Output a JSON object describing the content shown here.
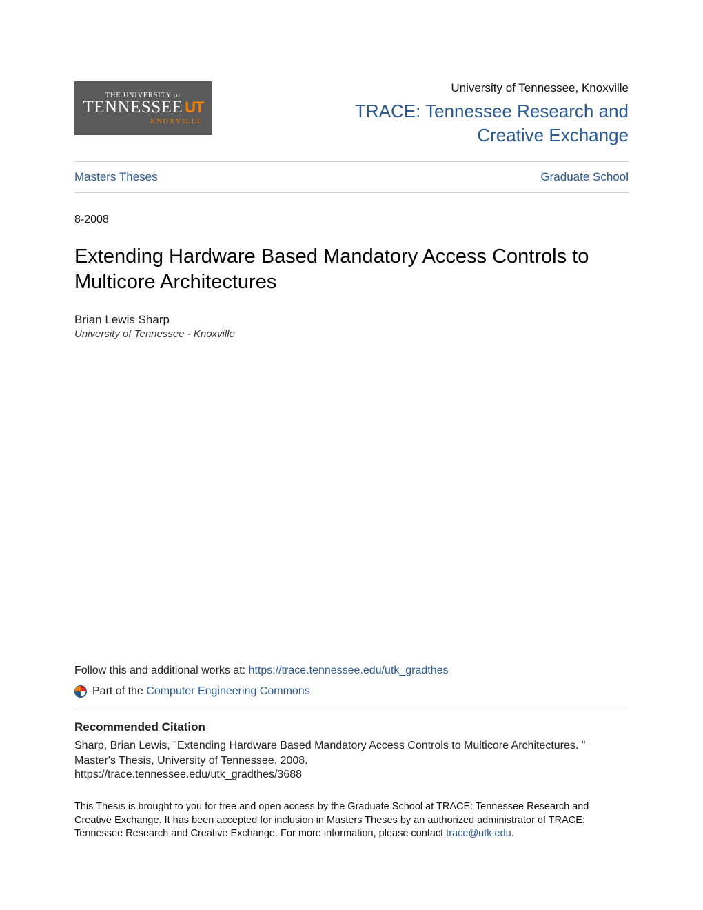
{
  "header": {
    "logo": {
      "line1": "THE UNIVERSITY of",
      "line2": "TENNESSEE",
      "ut_mark": "UT",
      "line3": "KNOXVILLE"
    },
    "institution": "University of Tennessee, Knoxville",
    "trace_label_prefix": "TRACE: ",
    "trace_label_rest": "Tennessee Research and Creative Exchange",
    "trace_full": "TRACE: Tennessee Research and Creative Exchange"
  },
  "nav": {
    "left_link": "Masters Theses",
    "right_link": "Graduate School"
  },
  "date": "8-2008",
  "title": "Extending Hardware Based Mandatory Access Controls to Multicore Architectures",
  "author": {
    "name": "Brian Lewis Sharp",
    "affiliation": "University of Tennessee - Knoxville"
  },
  "follow": {
    "prefix": "Follow this and additional works at: ",
    "url_text": "https://trace.tennessee.edu/utk_gradthes"
  },
  "network": {
    "prefix": "Part of the ",
    "link_text": "Computer Engineering Commons"
  },
  "citation": {
    "heading": "Recommended Citation",
    "text": "Sharp, Brian Lewis, \"Extending Hardware Based Mandatory Access Controls to Multicore Architectures. \" Master's Thesis, University of Tennessee, 2008.",
    "url": "https://trace.tennessee.edu/utk_gradthes/3688"
  },
  "footer": {
    "text_before_link": "This Thesis is brought to you for free and open access by the Graduate School at TRACE: Tennessee Research and Creative Exchange. It has been accepted for inclusion in Masters Theses by an authorized administrator of TRACE: Tennessee Research and Creative Exchange. For more information, please contact ",
    "link_text": "trace@utk.edu",
    "text_after_link": "."
  },
  "colors": {
    "link": "#2b5a8f",
    "logo_bg": "#5a5a5a",
    "logo_accent": "#f77f00"
  }
}
